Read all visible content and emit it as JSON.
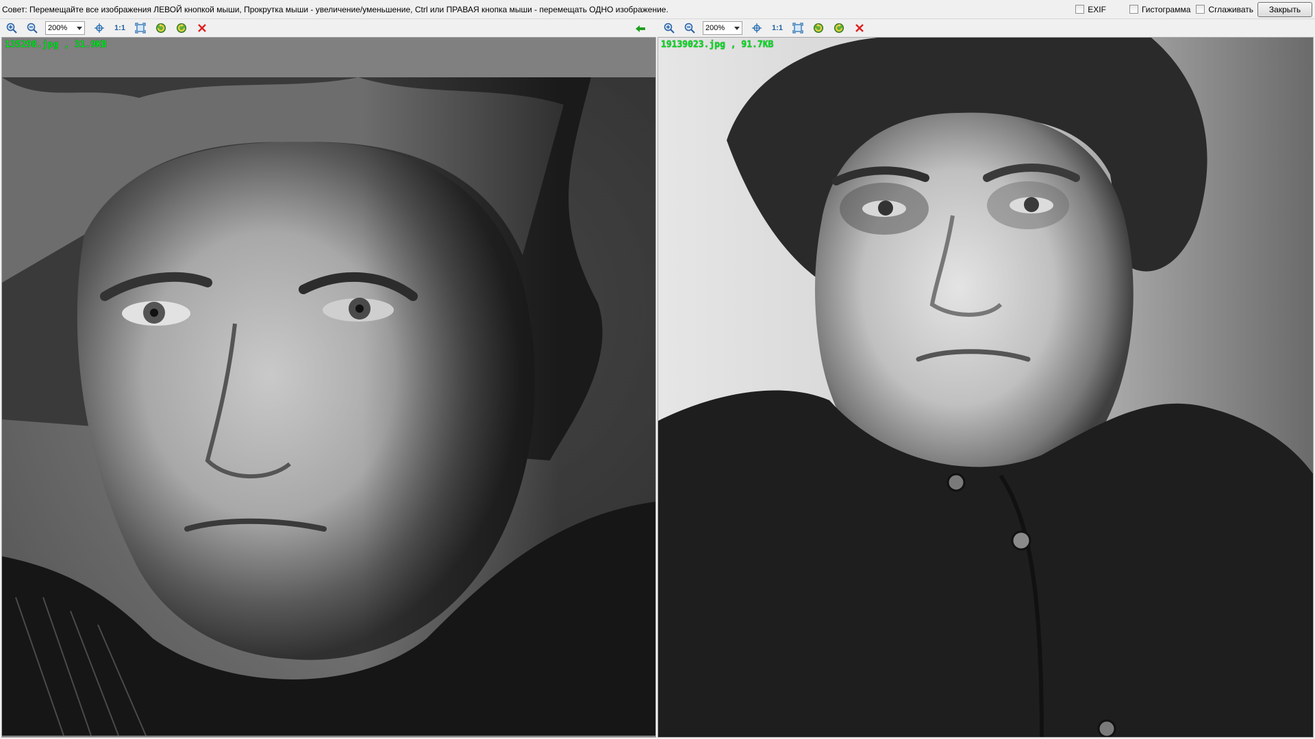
{
  "hint_text": "Совет: Перемещайте все изображения ЛЕВОЙ кнопкой мыши, Прокрутка мыши - увеличение/уменьшение, Ctrl или ПРАВАЯ кнопка мыши - перемещать ОДНО изображение.",
  "options": {
    "exif_label": "EXIF",
    "histogram_label": "Гистограмма",
    "smooth_label": "Сглаживать",
    "close_label": "Закрыть"
  },
  "left_pane": {
    "zoom_value": "200%",
    "one_to_one": "1:1",
    "file_label": "135298.jpg , 31.9KB"
  },
  "right_pane": {
    "zoom_value": "200%",
    "one_to_one": "1:1",
    "file_label": "19139023.jpg , 91.7KB"
  },
  "colors": {
    "file_label": "#00e020",
    "delete_icon": "#e02020",
    "back_arrow": "#20a020"
  }
}
